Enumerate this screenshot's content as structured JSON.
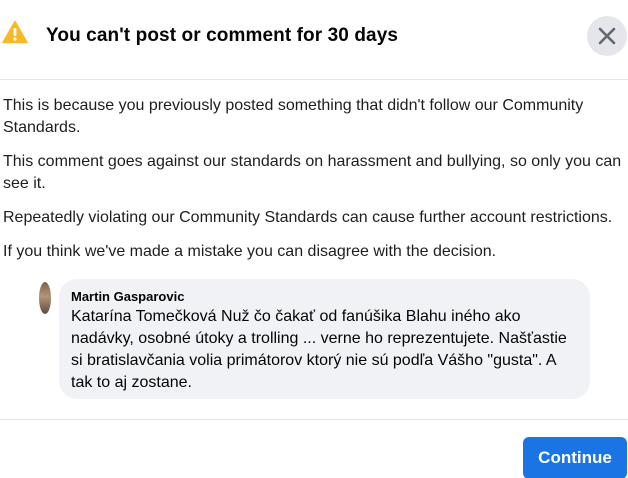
{
  "dialog": {
    "title": "You can't post or comment for 30 days",
    "icons": {
      "warning": "warning-triangle-icon",
      "close": "close-x-icon"
    },
    "colors": {
      "warning": "#f7b928",
      "primary_button": "#1b74e4"
    }
  },
  "content": {
    "paragraphs": [
      "This is because you previously posted something that didn't follow our Community Standards.",
      "This comment goes against our standards on harassment and bullying, so only you can see it.",
      "Repeatedly violating our Community Standards can cause further account restrictions.",
      "If you think we've made a mistake you can disagree with the decision."
    ]
  },
  "comment": {
    "author": "Martin Gasparovic",
    "text": "Katarína Tomečková Nuž čo čakať od fanúšika Blahu iného ako nadávky, osobné útoky a trolling ... verne ho reprezentujete. Našťastie si bratislavčania volia primátorov ktorý nie sú podľa Vášho \"gusta\". A tak to aj zostane."
  },
  "footer": {
    "continue_label": "Continue"
  }
}
